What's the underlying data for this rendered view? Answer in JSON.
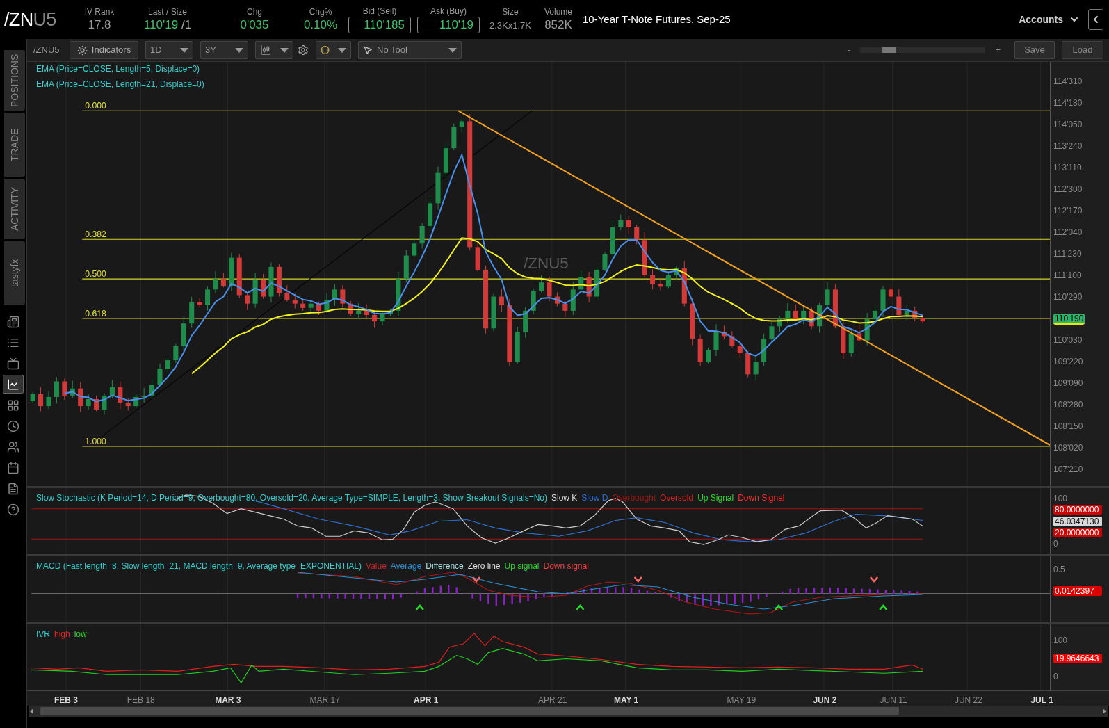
{
  "quote_bar": {
    "symbol_root": "/ZN",
    "symbol_month": "U5",
    "fields": [
      {
        "label": "IV Rank",
        "value": "17.8",
        "kind": "plain"
      },
      {
        "label": "Last / Size",
        "value": "110'19",
        "suffix": "/1",
        "kind": "change"
      },
      {
        "label": "Chg",
        "value": "0'035",
        "kind": "change"
      },
      {
        "label": "Chg%",
        "value": "0.10%",
        "kind": "change"
      },
      {
        "label": "Bid (Sell)",
        "value": "110'185",
        "kind": "box"
      },
      {
        "label": "Ask (Buy)",
        "value": "110'19",
        "kind": "box"
      },
      {
        "label": "Size",
        "value": "2.3Kx1.7K",
        "kind": "small"
      },
      {
        "label": "Volume",
        "value": "852K",
        "kind": "plain"
      }
    ],
    "description": "10-Year T-Note Futures, Sep-25",
    "accounts": "Accounts"
  },
  "rail": {
    "tabs": [
      "POSITIONS",
      "TRADE",
      "ACTIVITY",
      "tastyfx"
    ],
    "icons": [
      {
        "kind": "report",
        "selected": false
      },
      {
        "kind": "list",
        "selected": false
      },
      {
        "kind": "tv",
        "selected": false
      },
      {
        "kind": "chart",
        "selected": true
      },
      {
        "kind": "grid",
        "selected": false
      },
      {
        "kind": "clock",
        "selected": false
      },
      {
        "kind": "people",
        "selected": false
      },
      {
        "kind": "calendar",
        "selected": false
      },
      {
        "kind": "form",
        "selected": false
      },
      {
        "kind": "help",
        "selected": false
      }
    ]
  },
  "toolbar": {
    "symbol": "/ZNU5",
    "indicators": "Indicators",
    "aggregation": "1D",
    "range": "3Y",
    "tool": "No Tool",
    "zoom_minus": "-",
    "zoom_plus": "+",
    "zoom": {
      "level": 0.2
    },
    "save": "Save",
    "load": "Load"
  },
  "price_chart": {
    "studies": [
      "EMA (Price=CLOSE, Length=5, Displace=0)",
      "EMA (Price=CLOSE, Length=21, Displace=0)"
    ],
    "watermark": "/ZNU5",
    "fib_levels": [
      "0.000",
      "0.382",
      "0.500",
      "0.618",
      "1.000"
    ],
    "axis": [
      {
        "text": "114'310",
        "kind": "tick"
      },
      {
        "text": "114'180",
        "kind": "tick"
      },
      {
        "text": "114'050",
        "kind": "tick"
      },
      {
        "text": "113'240",
        "kind": "tick"
      },
      {
        "text": "113'110",
        "kind": "tick"
      },
      {
        "text": "112'300",
        "kind": "tick"
      },
      {
        "text": "112'170",
        "kind": "tick"
      },
      {
        "text": "112'040",
        "kind": "tick"
      },
      {
        "text": "111'230",
        "kind": "tick"
      },
      {
        "text": "111'100",
        "kind": "tick"
      },
      {
        "text": "110'290",
        "kind": "tick"
      },
      {
        "text": "110'190",
        "kind": "current"
      },
      {
        "text": "110'030",
        "kind": "tick"
      },
      {
        "text": "109'220",
        "kind": "tick"
      },
      {
        "text": "109'090",
        "kind": "tick"
      },
      {
        "text": "108'280",
        "kind": "tick"
      },
      {
        "text": "108'150",
        "kind": "tick"
      },
      {
        "text": "108'020",
        "kind": "tick"
      },
      {
        "text": "107'210",
        "kind": "tick"
      }
    ]
  },
  "stochastic": {
    "legend": [
      {
        "text": "Slow Stochastic (K Period=14, D Period=9, Overbought=80, Oversold=20, Average Type=SIMPLE, Length=3, Show Breakout Signals=No)",
        "color": "#33cccc"
      },
      {
        "text": "Slow K",
        "color": "#dddddd"
      },
      {
        "text": "Slow D",
        "color": "#2f6fd0"
      },
      {
        "text": "Overbought",
        "color": "#a01818"
      },
      {
        "text": "Oversold",
        "color": "#d02828"
      },
      {
        "text": "Up Signal",
        "color": "#22dd22"
      },
      {
        "text": "Down Signal",
        "color": "#ee3333"
      }
    ],
    "axis": [
      {
        "text": "100",
        "kind": "tick"
      },
      {
        "text": "80.0000000",
        "kind": "badge",
        "color": "#cc0000"
      },
      {
        "text": "46.0347130",
        "kind": "badge",
        "color": "#d8d8d8"
      },
      {
        "text": "20.0000000",
        "kind": "badge",
        "color": "#cc0000"
      },
      {
        "text": "0",
        "kind": "tick"
      }
    ]
  },
  "macd": {
    "legend": [
      {
        "text": "MACD (Fast length=8, Slow length=21, MACD length=9, Average type=EXPONENTIAL)",
        "color": "#33cccc"
      },
      {
        "text": "Value",
        "color": "#cc2222"
      },
      {
        "text": "Average",
        "color": "#2a8fd0"
      },
      {
        "text": "Difference",
        "color": "#a8e0e0"
      },
      {
        "text": "Zero line",
        "color": "#dddddd"
      },
      {
        "text": "Up signal",
        "color": "#22dd22"
      },
      {
        "text": "Down signal",
        "color": "#ee4444"
      }
    ],
    "axis": [
      {
        "text": "0.5",
        "kind": "tick"
      },
      {
        "text": "0.0142397",
        "kind": "badge",
        "color": "#dd0000"
      }
    ]
  },
  "ivr": {
    "legend": [
      {
        "text": "IVR",
        "color": "#33cccc"
      },
      {
        "text": "high",
        "color": "#ee2222"
      },
      {
        "text": "low",
        "color": "#22dd22"
      }
    ],
    "axis": [
      {
        "text": "100",
        "kind": "tick"
      },
      {
        "text": "19.9646643",
        "kind": "badge",
        "color": "#ee0000"
      },
      {
        "text": "0",
        "kind": "tick"
      }
    ]
  },
  "date_axis": [
    {
      "text": "FEB 3",
      "kind": "month"
    },
    {
      "text": "FEB 18",
      "kind": "day"
    },
    {
      "text": "MAR 3",
      "kind": "month"
    },
    {
      "text": "MAR 17",
      "kind": "day"
    },
    {
      "text": "APR 1",
      "kind": "month"
    },
    {
      "text": "APR 21",
      "kind": "day"
    },
    {
      "text": "MAY 1",
      "kind": "month"
    },
    {
      "text": "MAY 19",
      "kind": "day"
    },
    {
      "text": "JUN 2",
      "kind": "month"
    },
    {
      "text": "JUN 11",
      "kind": "day"
    },
    {
      "text": "JUN 22",
      "kind": "day"
    },
    {
      "text": "JUL 1",
      "kind": "month"
    }
  ]
}
